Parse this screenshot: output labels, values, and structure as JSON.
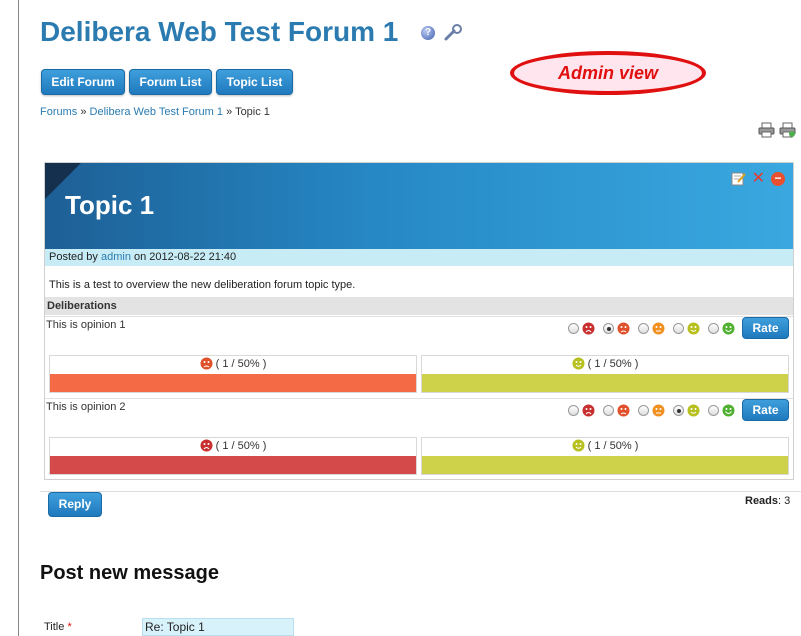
{
  "forum": {
    "title": "Delibera Web Test Forum 1",
    "help_icon": "?"
  },
  "toolbar": {
    "edit_forum": "Edit Forum",
    "forum_list": "Forum List",
    "topic_list": "Topic List"
  },
  "annotation": {
    "admin_view": "Admin view"
  },
  "breadcrumb": {
    "forums": "Forums",
    "sep1": "»",
    "forum": "Delibera Web Test Forum 1",
    "sep2": "»",
    "topic": "Topic 1"
  },
  "topic": {
    "title": "Topic 1",
    "posted_prefix": "Posted by ",
    "author": "admin",
    "posted_suffix": " on 2012-08-22 21:40",
    "body": "This is a test to overview the new deliberation forum topic type.",
    "close_icon": "✕",
    "delete_icon": "−"
  },
  "deliberations": {
    "header": "Deliberations",
    "rate_label": "Rate",
    "opinions": [
      {
        "text": "This is opinion 1",
        "selected_rating": 2,
        "results": [
          {
            "label": "( 1 / 50% )",
            "color": "#f36a45"
          },
          {
            "label": "( 1 / 50% )",
            "color": "#cdd24a"
          }
        ]
      },
      {
        "text": "This is opinion 2",
        "selected_rating": 4,
        "results": [
          {
            "label": "( 1 / 50% )",
            "color": "#d44a4a"
          },
          {
            "label": "( 1 / 50% )",
            "color": "#cdd24a"
          }
        ]
      }
    ]
  },
  "reply": {
    "label": "Reply",
    "reads_label": "Reads",
    "reads_value": ": 3"
  },
  "post_form": {
    "heading": "Post new message",
    "title_label": "Title",
    "required_mark": "*",
    "title_value": "Re: Topic 1"
  },
  "colors": {
    "accent": "#2b7bb0",
    "button": "#1f79bd",
    "admin_red": "#e01010"
  }
}
